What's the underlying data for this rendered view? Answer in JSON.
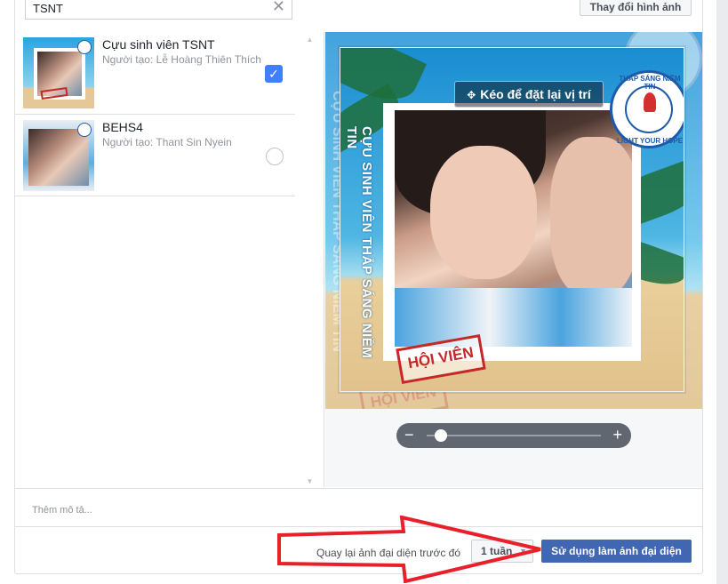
{
  "search": {
    "value": "TSNT"
  },
  "header": {
    "change_photo_label": "Thay đổi hình ảnh"
  },
  "frames": [
    {
      "title": "Cựu sinh viên TSNT",
      "creator": "Người tạo: Lễ Hoàng Thiên Thích",
      "selected": true
    },
    {
      "title": "BEHS4",
      "creator": "Người tạo: Thant Sin Nyein",
      "selected": false
    }
  ],
  "preview": {
    "drag_label": "Kéo để đặt lại vị trí",
    "frame_vertical_text": "CỰU SINH VIÊN THẮP SÁNG NIỀM TIN",
    "frame_ghost_text": "CỰU SINH VIÊN THẮP SÁNG NIỀM TIN",
    "stamp_text": "HỘI VIÊN",
    "logo_text": "THẮP SÁNG NIỀM TIN",
    "logo_bottom_text": "LIGHT YOUR HOPE",
    "zoom_level": 0.08
  },
  "description": {
    "placeholder": "Thêm mô tả..."
  },
  "footer": {
    "revert_label": "Quay lại ảnh đại diện trước đó",
    "duration_value": "1 tuần",
    "use_as_profile_label": "Sử dụng làm ảnh đại diện"
  },
  "colors": {
    "primary": "#4267b2",
    "check": "#4080ff",
    "annotation_arrow": "#e8202a"
  }
}
